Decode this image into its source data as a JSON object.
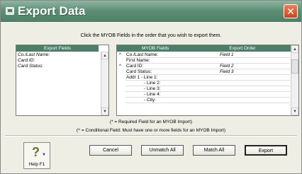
{
  "window": {
    "title": "Export Data",
    "close_symbol": "✕"
  },
  "instruction": "Click the MYOB Fields in the order that you wish to export them.",
  "export_fields": {
    "header": "Export Fields",
    "items": [
      "Co./Last Name:",
      "Card ID:",
      "Card Status:"
    ]
  },
  "myob_fields": {
    "header_field": "MYOB Fields",
    "header_order": "Export Order",
    "rows": [
      {
        "mark": "^",
        "name": "Co./Last Name:",
        "order": "Field 1",
        "indent": false
      },
      {
        "mark": "",
        "name": "First Name:",
        "order": "",
        "indent": false
      },
      {
        "mark": "^",
        "name": "Card ID:",
        "order": "Field 2",
        "indent": false
      },
      {
        "mark": "",
        "name": "Card Status:",
        "order": "Field 3",
        "indent": false
      },
      {
        "mark": "",
        "name": "Addr 1 - Line 1:",
        "order": "",
        "indent": false
      },
      {
        "mark": "",
        "name": "- Line 2:",
        "order": "",
        "indent": true
      },
      {
        "mark": "",
        "name": "- Line 3:",
        "order": "",
        "indent": true
      },
      {
        "mark": "",
        "name": "- Line 4:",
        "order": "",
        "indent": true
      },
      {
        "mark": "",
        "name": "- City:",
        "order": "",
        "indent": true
      }
    ]
  },
  "notes": {
    "required": "(* = Required Field for an MYOB Import)",
    "conditional": "(^ = Conditional Field: Must have one or more fields for an MYOB Import)"
  },
  "buttons": {
    "help": "Help F1",
    "cancel": "Cancel",
    "unmatch_all": "Unmatch All",
    "match_all": "Match All",
    "export": "Export"
  },
  "icons": {
    "help": "help-question-icon",
    "scroll_up": "scroll-up-arrow-icon",
    "scroll_down": "scroll-down-arrow-icon"
  }
}
